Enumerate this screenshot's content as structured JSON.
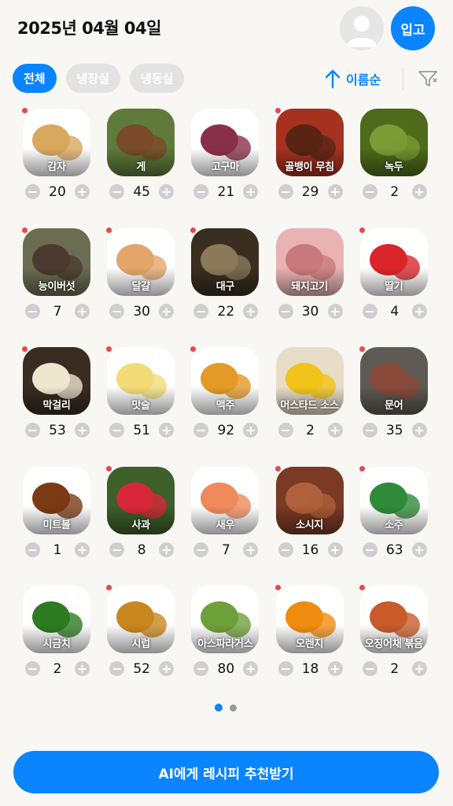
{
  "header": {
    "date": "2025년 04월 04일",
    "checkin_label": "입고",
    "avatar_icon": "user-avatar-icon"
  },
  "filters": {
    "tabs": [
      {
        "label": "전체",
        "active": true
      },
      {
        "label": "냉장실",
        "active": false
      },
      {
        "label": "냉동실",
        "active": false
      }
    ],
    "sort_label": "이름순",
    "sort_icon": "arrow-up-icon",
    "filter_icon": "filter-icon"
  },
  "colors": {
    "accent": "#0a84ff",
    "alert_dot": "#e5484d",
    "chip_inactive": "#e3e3e3",
    "stepper": "#cfcfcf"
  },
  "items": [
    {
      "name": "감자",
      "qty": "20",
      "alert": true,
      "colors": [
        "#ffffff",
        "#d9a75e"
      ]
    },
    {
      "name": "게",
      "qty": "45",
      "alert": false,
      "colors": [
        "#5f7a3a",
        "#7a4a2a"
      ]
    },
    {
      "name": "고구마",
      "qty": "21",
      "alert": false,
      "colors": [
        "#ffffff",
        "#8a2f4a"
      ]
    },
    {
      "name": "골뱅이 무침",
      "qty": "29",
      "alert": true,
      "colors": [
        "#a4321f",
        "#5a2414"
      ]
    },
    {
      "name": "녹두",
      "qty": "2",
      "alert": false,
      "colors": [
        "#4e6b1c",
        "#7c9a35"
      ]
    },
    {
      "name": "능이버섯",
      "qty": "7",
      "alert": true,
      "colors": [
        "#6a6d52",
        "#4c3a30"
      ]
    },
    {
      "name": "달걀",
      "qty": "30",
      "alert": true,
      "colors": [
        "#ffffff",
        "#e2a66a"
      ]
    },
    {
      "name": "대구",
      "qty": "22",
      "alert": true,
      "colors": [
        "#3a2e20",
        "#8a7a5a"
      ]
    },
    {
      "name": "돼지고기",
      "qty": "30",
      "alert": false,
      "colors": [
        "#e9b3b3",
        "#c9797c"
      ]
    },
    {
      "name": "딸기",
      "qty": "4",
      "alert": true,
      "colors": [
        "#ffffff",
        "#d9252b"
      ]
    },
    {
      "name": "막걸리",
      "qty": "53",
      "alert": true,
      "colors": [
        "#3a2c20",
        "#efe6cf"
      ]
    },
    {
      "name": "맛술",
      "qty": "51",
      "alert": true,
      "colors": [
        "#ffffff",
        "#f2dc78"
      ]
    },
    {
      "name": "맥주",
      "qty": "92",
      "alert": true,
      "colors": [
        "#ffffff",
        "#e39a26"
      ]
    },
    {
      "name": "머스타드 소스",
      "qty": "2",
      "alert": false,
      "colors": [
        "#e8ddc8",
        "#f2c318"
      ]
    },
    {
      "name": "문어",
      "qty": "35",
      "alert": true,
      "colors": [
        "#5e5a54",
        "#8a4a3a"
      ]
    },
    {
      "name": "미트볼",
      "qty": "1",
      "alert": false,
      "colors": [
        "#ffffff",
        "#7a3a14"
      ]
    },
    {
      "name": "사과",
      "qty": "8",
      "alert": true,
      "colors": [
        "#3d5f2a",
        "#d6283a"
      ]
    },
    {
      "name": "새우",
      "qty": "7",
      "alert": false,
      "colors": [
        "#ffffff",
        "#f08a5a"
      ]
    },
    {
      "name": "소시지",
      "qty": "16",
      "alert": true,
      "colors": [
        "#7a3a24",
        "#b0603a"
      ]
    },
    {
      "name": "소주",
      "qty": "63",
      "alert": true,
      "colors": [
        "#ffffff",
        "#2f8a3a"
      ]
    },
    {
      "name": "시금치",
      "qty": "2",
      "alert": false,
      "colors": [
        "#ffffff",
        "#2e7a22"
      ]
    },
    {
      "name": "시럽",
      "qty": "52",
      "alert": true,
      "colors": [
        "#ffffff",
        "#c9871f"
      ]
    },
    {
      "name": "아스파라거스",
      "qty": "80",
      "alert": false,
      "colors": [
        "#ffffff",
        "#6ea03a"
      ]
    },
    {
      "name": "오렌지",
      "qty": "18",
      "alert": true,
      "colors": [
        "#ffffff",
        "#f08c10"
      ]
    },
    {
      "name": "오징어채 볶음",
      "qty": "2",
      "alert": true,
      "colors": [
        "#ffffff",
        "#c95a2a"
      ]
    }
  ],
  "pagination": {
    "pages": 2,
    "current": 0
  },
  "cta_label": "AI에게 레시피 추천받기"
}
